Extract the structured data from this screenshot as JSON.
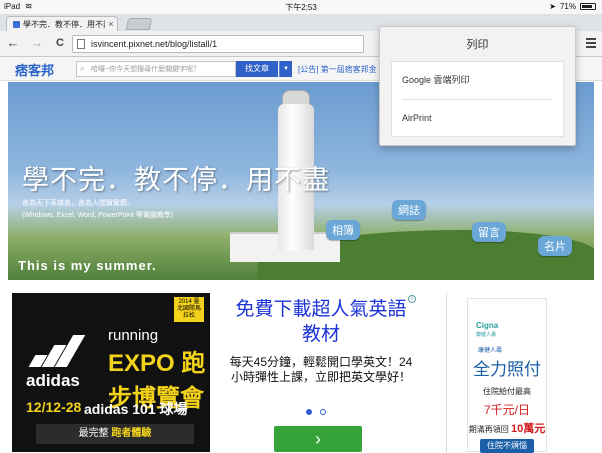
{
  "status_bar": {
    "carrier": "iPad",
    "wifi_icon": "wifi-icon",
    "clock": "下午2:53",
    "battery": "71%"
  },
  "tab": {
    "title": "學不完．教不停．用不盡",
    "close": "×"
  },
  "toolbar": {
    "back": "←",
    "forward": "→",
    "reload": "C",
    "url": "isvincent.pixnet.net/blog/listall/1"
  },
  "site_bar": {
    "logo": "痞客邦",
    "search_placeholder": "哈囉~你今天想搜尋什麼關鍵字呢？",
    "search_button": "找文章",
    "dropdown_caret": "▼",
    "announcement": "[公告] 第一屆痞客邦金"
  },
  "banner": {
    "title": "學不完．教不停．用不盡",
    "subtitle_line1": "善為天下英雄善，善為人間實實模。",
    "subtitle_line2": "(Windows, Excel, Word, PowerPoint 等電腦教學)",
    "summer_text": "This is my summer.",
    "signs": [
      "相簿",
      "網誌",
      "留言",
      "名片"
    ]
  },
  "ad_left": {
    "badge": "2014 臺北國際馬拉松",
    "brand": "adidas",
    "running": "running",
    "expo": "EXPO 跑步博覽會",
    "dates": "12/12-28",
    "venue": "adidas 101 球場",
    "cta_prefix": "最完整",
    "cta_highlight": "跑者體驗"
  },
  "ad_center": {
    "info_icon": "i",
    "headline": "免費下載超人氣英語教材",
    "body": "每天45分鐘，輕鬆開口學英文！24小時彈性上課，立即把英文學好！",
    "go_button": "›"
  },
  "ad_right": {
    "brand": "Cigna",
    "brand_sub": "康健人壽",
    "line1": "康健人壽",
    "line2": "全力照付",
    "line3": "住院給付最高",
    "line4": "7千元/日",
    "line5_prefix": "期滿再領回",
    "line5_highlight": "10萬元",
    "button": "住院不煩惱"
  },
  "print_menu": {
    "title": "列印",
    "options": [
      "Google 雲端列印",
      "AirPrint"
    ]
  }
}
